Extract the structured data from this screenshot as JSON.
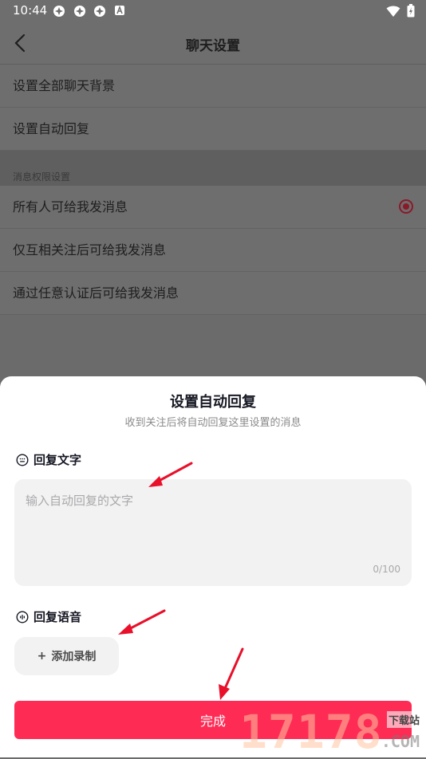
{
  "status_bar": {
    "time": "10:44",
    "notification_icons": [
      "app-notification-icon",
      "app-notification-icon",
      "app-notification-icon",
      "a-icon"
    ],
    "right_icons": [
      "wifi-icon",
      "battery-icon"
    ]
  },
  "nav": {
    "title": "聊天设置"
  },
  "settings": {
    "items": [
      {
        "label": "设置全部聊天背景"
      },
      {
        "label": "设置自动回复"
      }
    ],
    "section_header": "消息权限设置",
    "permission_options": [
      {
        "label": "所有人可给我发消息",
        "selected": true
      },
      {
        "label": "仅互相关注后可给我发消息",
        "selected": false
      },
      {
        "label": "通过任意认证后可给我发消息",
        "selected": false
      }
    ]
  },
  "sheet": {
    "title": "设置自动回复",
    "subtitle": "收到关注后将自动回复这里设置的消息",
    "text_section_label": "回复文字",
    "text_placeholder": "输入自动回复的文字",
    "text_value": "",
    "char_counter": "0/100",
    "voice_section_label": "回复语音",
    "add_recording_label": "添加录制",
    "add_recording_prefix": "+",
    "done_label": "完成"
  },
  "watermark": {
    "digits": "17178",
    "caption": "下载站",
    "domain": ".COM"
  },
  "colors": {
    "accent": "#fe2c55",
    "annotation_arrow": "#e8102a",
    "overlay": "#6b6b6b"
  }
}
